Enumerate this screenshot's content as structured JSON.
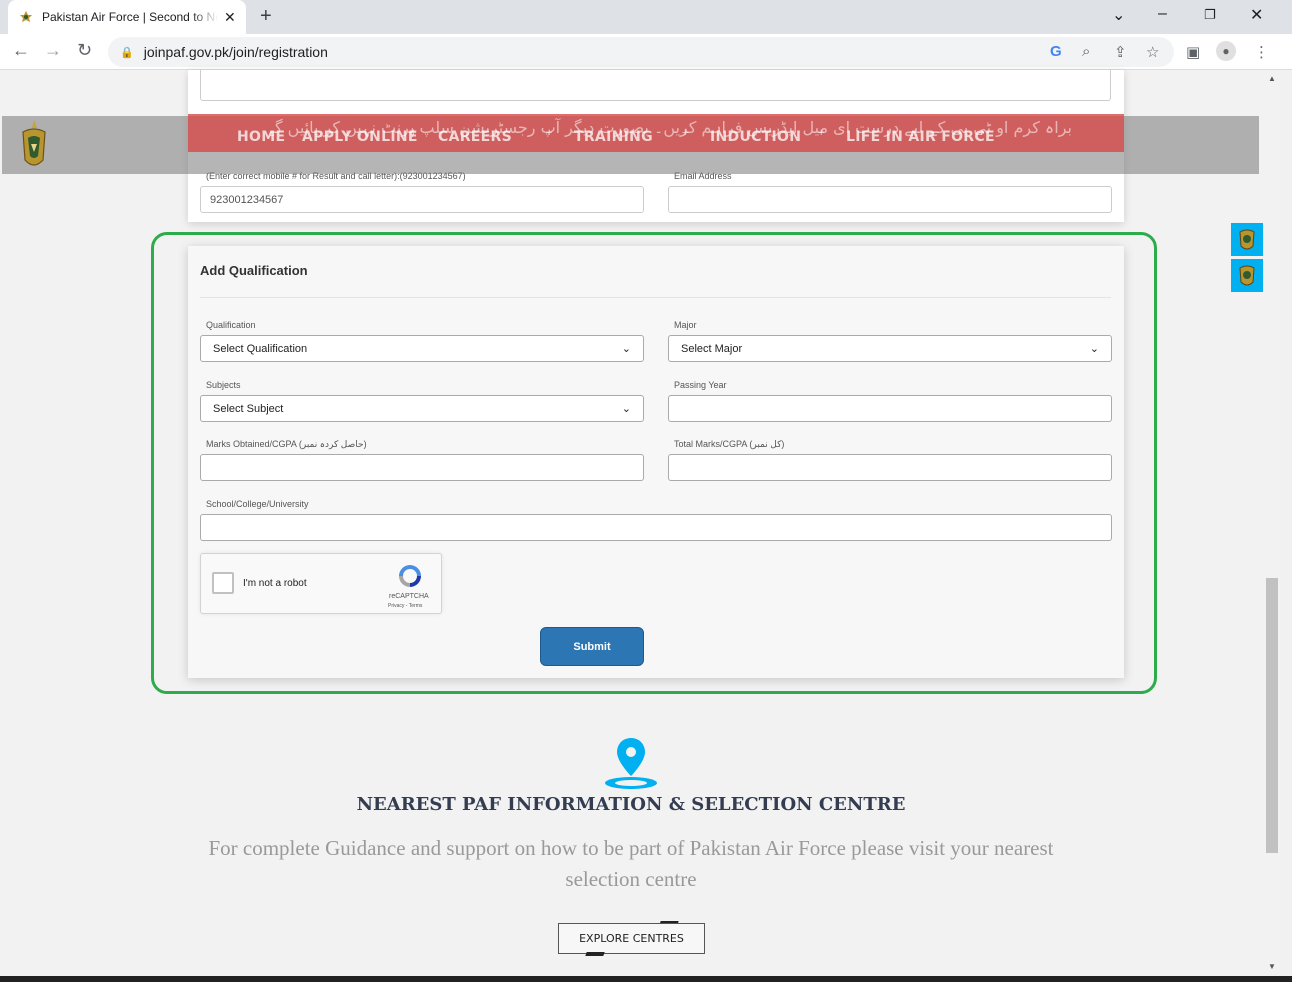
{
  "browser": {
    "tab_title": "Pakistan Air Force | Second to None",
    "url": "joinpaf.gov.pk/join/registration",
    "icons": [
      "back-icon",
      "forward-icon",
      "reload-icon",
      "lock-icon",
      "google-icon",
      "zoom-icon",
      "share-icon",
      "bookmark-star-icon",
      "sidepanel-icon",
      "profile-icon",
      "menu-icon"
    ]
  },
  "nav": {
    "items": [
      "HOME",
      "APPLY ONLINE",
      "CAREERS",
      "TRAINING",
      "INDUCTION",
      "LIFE IN AIR FORCE"
    ],
    "notice_urdu": "براہ کرم او ٹی پی کے لیے درست ای میل ایڈریس فراہم کریں۔ بصورت دیگر آپ رجسٹریشن سلپ پرنٹ نہیں کر پائیں گے"
  },
  "contact": {
    "mobile_label": "(Enter correct mobile # for Result and call letter):(923001234567)",
    "mobile_placeholder": "923001234567",
    "email_label": "Email Address"
  },
  "qualification": {
    "title": "Add Qualification",
    "qualification_label": "Qualification",
    "qualification_value": "Select Qualification",
    "major_label": "Major",
    "major_value": "Select Major",
    "subjects_label": "Subjects",
    "subjects_value": "Select Subject",
    "passing_year_label": "Passing Year",
    "marks_label": "Marks Obtained/CGPA (حاصل کردہ نمبر)",
    "total_label": "Total Marks/CGPA (کل نمبر)",
    "school_label": "School/College/University",
    "captcha_label": "I'm not a robot",
    "captcha_brand": "reCAPTCHA",
    "captcha_links": "Privacy - Terms",
    "submit_label": "Submit"
  },
  "nearest": {
    "title": "NEAREST PAF INFORMATION & SELECTION CENTRE",
    "description": "For complete Guidance and support on how to be part of Pakistan Air Force please visit your nearest selection centre",
    "button_label": "EXPLORE CENTRES"
  },
  "colors": {
    "highlight": "#2eab4b",
    "submit": "#2d76b4",
    "nav_red": "#d64848",
    "pin": "#00b0f0"
  }
}
